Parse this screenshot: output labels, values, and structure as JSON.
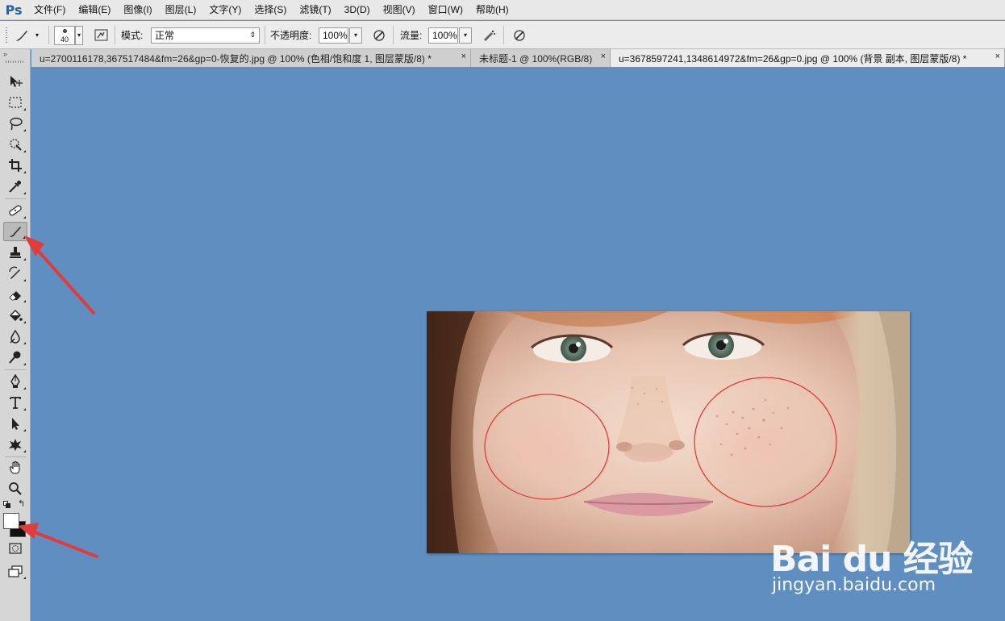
{
  "app": {
    "logo": "Ps"
  },
  "menu": [
    "文件(F)",
    "编辑(E)",
    "图像(I)",
    "图层(L)",
    "文字(Y)",
    "选择(S)",
    "滤镜(T)",
    "3D(D)",
    "视图(V)",
    "窗口(W)",
    "帮助(H)"
  ],
  "options": {
    "brush_size": "40",
    "mode_label": "模式:",
    "mode_value": "正常",
    "opacity_label": "不透明度:",
    "opacity_value": "100%",
    "flow_label": "流量:",
    "flow_value": "100%"
  },
  "tabs": [
    {
      "label": "u=2700116178,367517484&fm=26&gp=0-恢复的.jpg @ 100% (色相/饱和度 1, 图层蒙版/8) *",
      "close": "×"
    },
    {
      "label": "未标题-1 @ 100%(RGB/8)",
      "close": "×"
    },
    {
      "label": "u=3678597241,1348614972&fm=26&gp=0.jpg @ 100% (背景 副本, 图层蒙版/8) *",
      "close": "×"
    }
  ],
  "active_tab_index": 2,
  "tools": [
    "move-tool-icon",
    "marquee-tool-icon",
    "lasso-tool-icon",
    "quick-selection-tool-icon",
    "crop-tool-icon",
    "eyedropper-tool-icon",
    "healing-brush-tool-icon",
    "brush-tool-icon",
    "clone-stamp-tool-icon",
    "history-brush-tool-icon",
    "eraser-tool-icon",
    "paint-bucket-tool-icon",
    "blur-tool-icon",
    "dodge-tool-icon",
    "pen-tool-icon",
    "type-tool-icon",
    "path-selection-tool-icon",
    "custom-shape-tool-icon",
    "hand-tool-icon",
    "zoom-tool-icon"
  ],
  "colors": {
    "canvas_bg": "#5f8ec0",
    "foreground_swatch": "#ffffff",
    "background_swatch": "#111111",
    "annotation_red": "#e23b3b"
  },
  "watermark": {
    "brand": "Bai du 经验",
    "url": "jingyan.baidu.com"
  }
}
